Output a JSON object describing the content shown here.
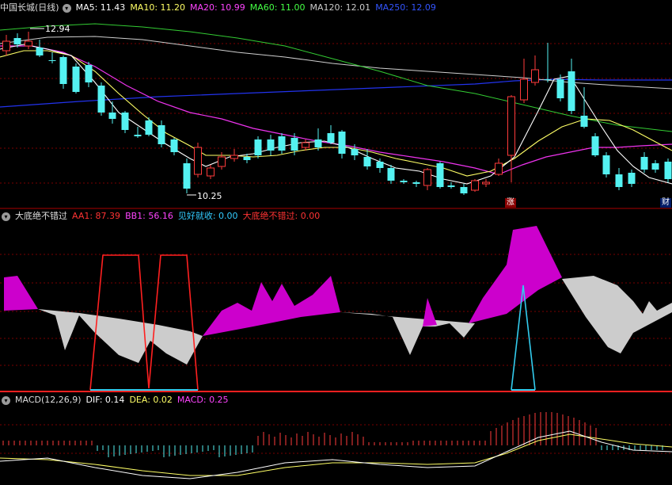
{
  "main": {
    "title": "中国长城(日线)",
    "indicators": [
      {
        "label": "MA5: 11.43",
        "color": "#ffffff"
      },
      {
        "label": "MA10: 11.20",
        "color": "#ffff66"
      },
      {
        "label": "MA20: 10.99",
        "color": "#ff44ff"
      },
      {
        "label": "MA60: 11.00",
        "color": "#44ff44"
      },
      {
        "label": "MA120: 12.01",
        "color": "#cccccc"
      },
      {
        "label": "MA250: 12.09",
        "color": "#3355ff"
      }
    ],
    "high_label": "12.94",
    "low_label": "10.25",
    "badge_zhang": "涨",
    "badge_cai": "财"
  },
  "indicator_panel": {
    "title": "大底绝不错过",
    "fields": [
      {
        "label": "AA1: 87.39",
        "color": "#ff3333"
      },
      {
        "label": "BB1: 56.16",
        "color": "#ff44ff"
      },
      {
        "label": "见好就收: 0.00",
        "color": "#33ccff"
      },
      {
        "label": "大底绝不错过: 0.00",
        "color": "#ff3333"
      }
    ]
  },
  "macd_panel": {
    "title": "MACD(12,26,9)",
    "fields": [
      {
        "label": "DIF: 0.14",
        "color": "#ffffff"
      },
      {
        "label": "DEA: 0.02",
        "color": "#ffff66"
      },
      {
        "label": "MACD: 0.25",
        "color": "#ff44ff"
      }
    ]
  },
  "colors": {
    "up": "#ff3b3b",
    "down": "#54f1f1",
    "grid": "#7a0000"
  }
}
